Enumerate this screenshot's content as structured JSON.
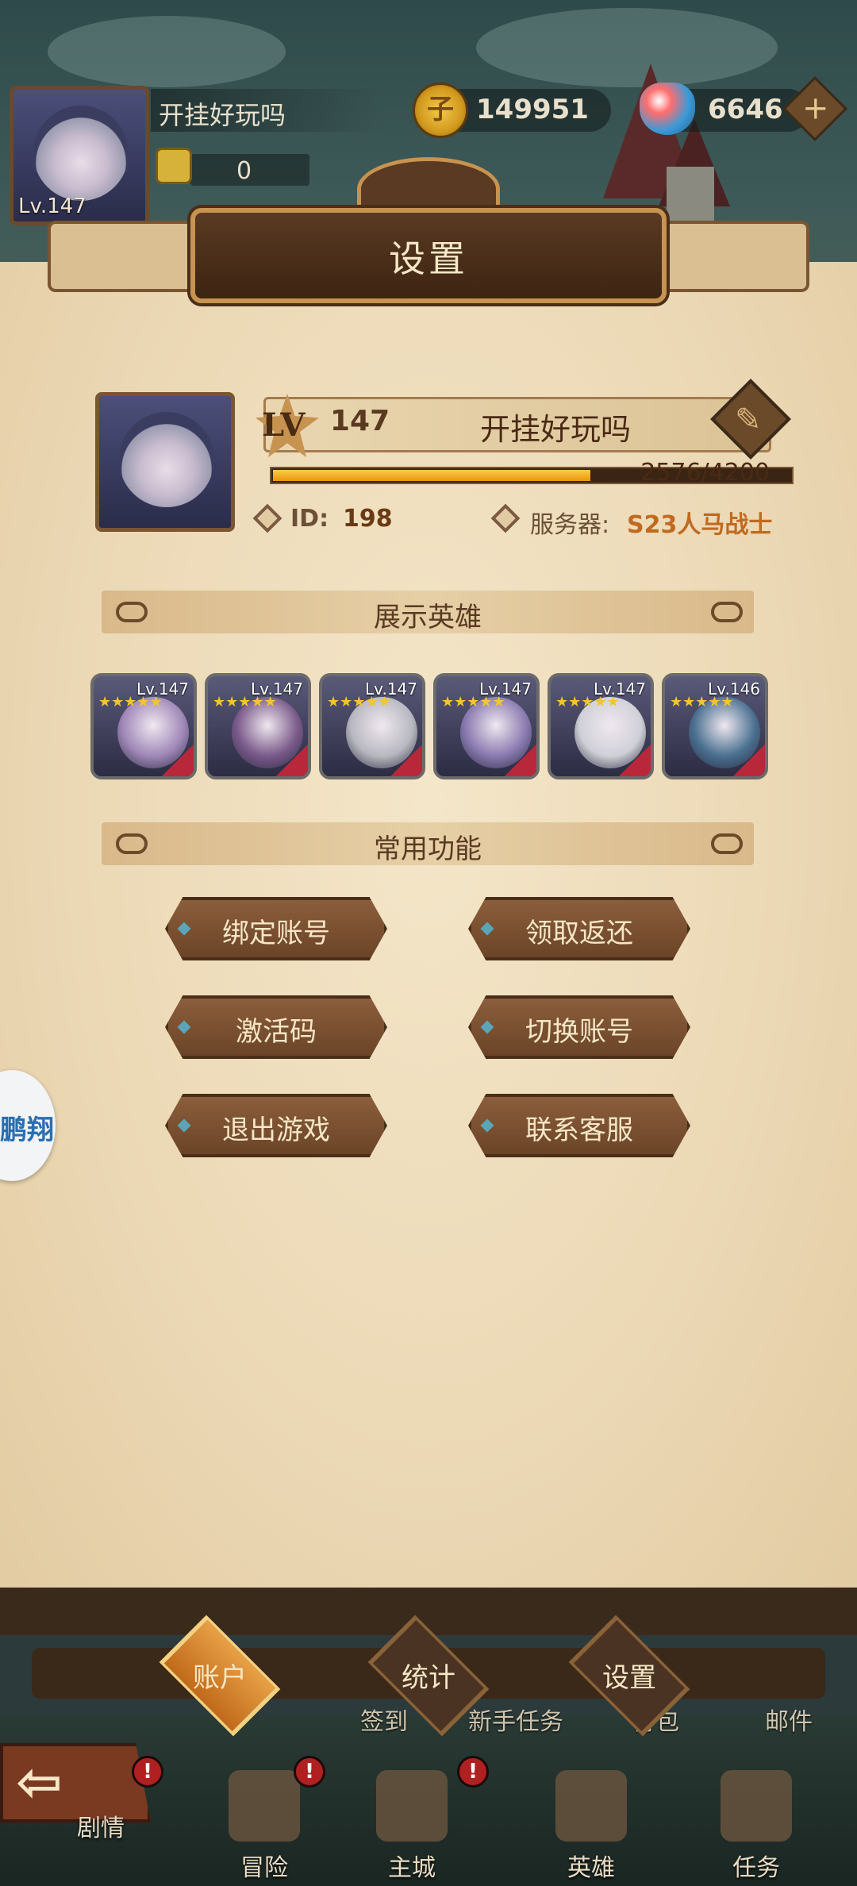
{
  "hud": {
    "player_name": "开挂好玩吗",
    "level": "Lv.147",
    "fist_value": "0",
    "gold": "149951",
    "gems": "6646",
    "gold_symbol": "子"
  },
  "panel": {
    "title": "设置",
    "lv_badge": "LV",
    "level_num": "147",
    "name": "开挂好玩吗",
    "xp_text": "2576/4200",
    "xp_progress": 0.613,
    "id_label": "ID:",
    "id_value": "198",
    "server_label": "服务器:",
    "server_value": "S23人马战士"
  },
  "showcase": {
    "title": "展示英雄",
    "heroes": [
      {
        "level": "Lv.147",
        "stars": 5,
        "color": "#a088b8"
      },
      {
        "level": "Lv.147",
        "stars": 5,
        "color": "#7a5a8a"
      },
      {
        "level": "Lv.147",
        "stars": 5,
        "color": "#b8b8c0"
      },
      {
        "level": "Lv.147",
        "stars": 5,
        "color": "#8a7ab0"
      },
      {
        "level": "Lv.147",
        "stars": 5,
        "color": "#d0d0d8"
      },
      {
        "level": "Lv.146",
        "stars": 5,
        "color": "#4a7090"
      }
    ]
  },
  "functions": {
    "title": "常用功能",
    "bind_account": "绑定账号",
    "claim_rebate": "领取返还",
    "activation_code": "激活码",
    "switch_account": "切换账号",
    "exit_game": "退出游戏",
    "contact_support": "联系客服"
  },
  "float_badge": {
    "text": "鹏翔"
  },
  "tabs": {
    "account": "账户",
    "stats": "统计",
    "settings": "设置"
  },
  "menu_row": {
    "signin": "签到",
    "newbie_tasks": "新手任务",
    "bag": "背包",
    "mail": "邮件"
  },
  "nav": {
    "story": "剧情",
    "adventure": "冒险",
    "main_city": "主城",
    "heroes": "英雄",
    "tasks": "任务",
    "alert_symbol": "!"
  },
  "colors": {
    "accent": "#c06a1a",
    "panel_bg": "#ecd9b6",
    "xp_fill": "#e8960e",
    "server_value": "#c06a20"
  }
}
